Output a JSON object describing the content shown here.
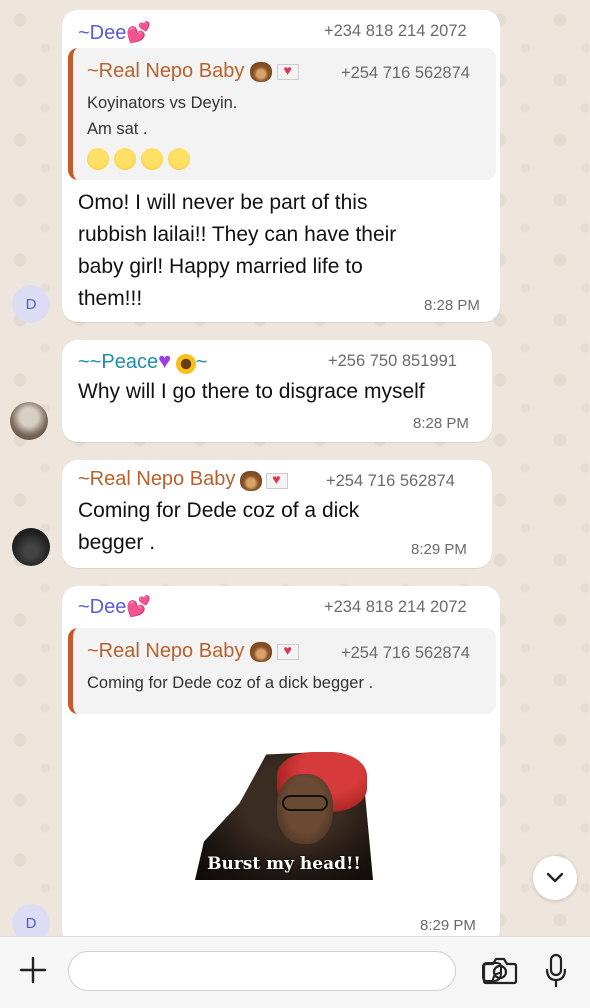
{
  "messages": [
    {
      "sender": "~Dee",
      "phone": "+234 818 214 2072",
      "quote": {
        "sender": "~Real Nepo Baby",
        "phone": "+254 716 562874",
        "lines": [
          "Koyinators  vs Deyin.",
          "Am sat ."
        ]
      },
      "text_lines": [
        "Omo! I will never be part of this",
        "rubbish lailai!! They can have their",
        "baby girl! Happy married life to",
        "them!!!"
      ],
      "time": "8:28 PM",
      "avatar": "D"
    },
    {
      "sender": "~~Peace",
      "sender_suffix": "~",
      "phone": "+256 750 851991",
      "text_lines": [
        "Why will I go there to disgrace myself"
      ],
      "time": "8:28 PM"
    },
    {
      "sender": "~Real Nepo Baby",
      "phone": "+254 716 562874",
      "text_lines": [
        "Coming for Dede coz of a dick",
        "begger ."
      ],
      "time": "8:29 PM"
    },
    {
      "sender": "~Dee",
      "phone": "+234 818 214 2072",
      "quote": {
        "sender": "~Real Nepo Baby",
        "phone": "+254 716 562874",
        "lines": [
          "Coming for Dede coz of a dick begger ."
        ]
      },
      "sticker_caption": "Burst my head!!",
      "time": "8:29 PM",
      "avatar": "D"
    }
  ],
  "icons": [
    "plus-icon",
    "sticker-icon",
    "camera-icon",
    "microphone-icon",
    "chevron-down-icon"
  ]
}
